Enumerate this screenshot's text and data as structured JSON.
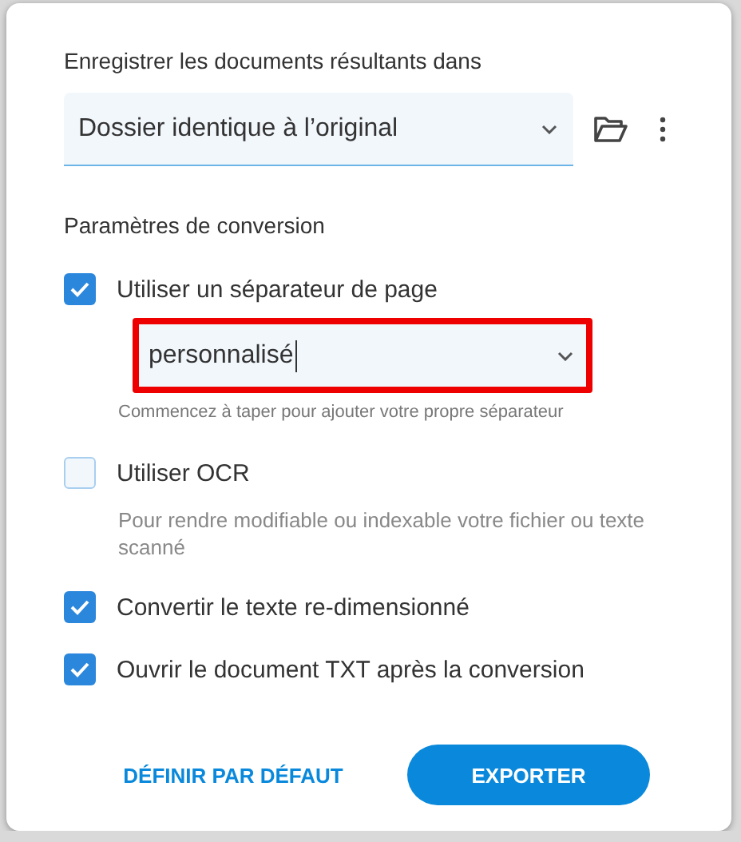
{
  "destination": {
    "label": "Enregistrer les documents résultants dans",
    "value": "Dossier identique à l’original"
  },
  "conversion": {
    "heading": "Paramètres de conversion",
    "options": [
      {
        "label": "Utiliser un séparateur de page",
        "checked": true,
        "separator": {
          "value": "personnalisé",
          "highlighted": true,
          "hint": "Commencez à taper pour ajouter votre propre séparateur"
        }
      },
      {
        "label": "Utiliser OCR",
        "checked": false,
        "description": "Pour rendre modifiable ou indexable votre fichier ou texte scanné"
      },
      {
        "label": "Convertir le texte re-dimensionné",
        "checked": true
      },
      {
        "label": "Ouvrir le document TXT après la conversion",
        "checked": true
      }
    ]
  },
  "buttons": [
    {
      "label": "DÉFINIR PAR DÉFAUT",
      "kind": "text"
    },
    {
      "label": "EXPORTER",
      "kind": "primary"
    }
  ]
}
